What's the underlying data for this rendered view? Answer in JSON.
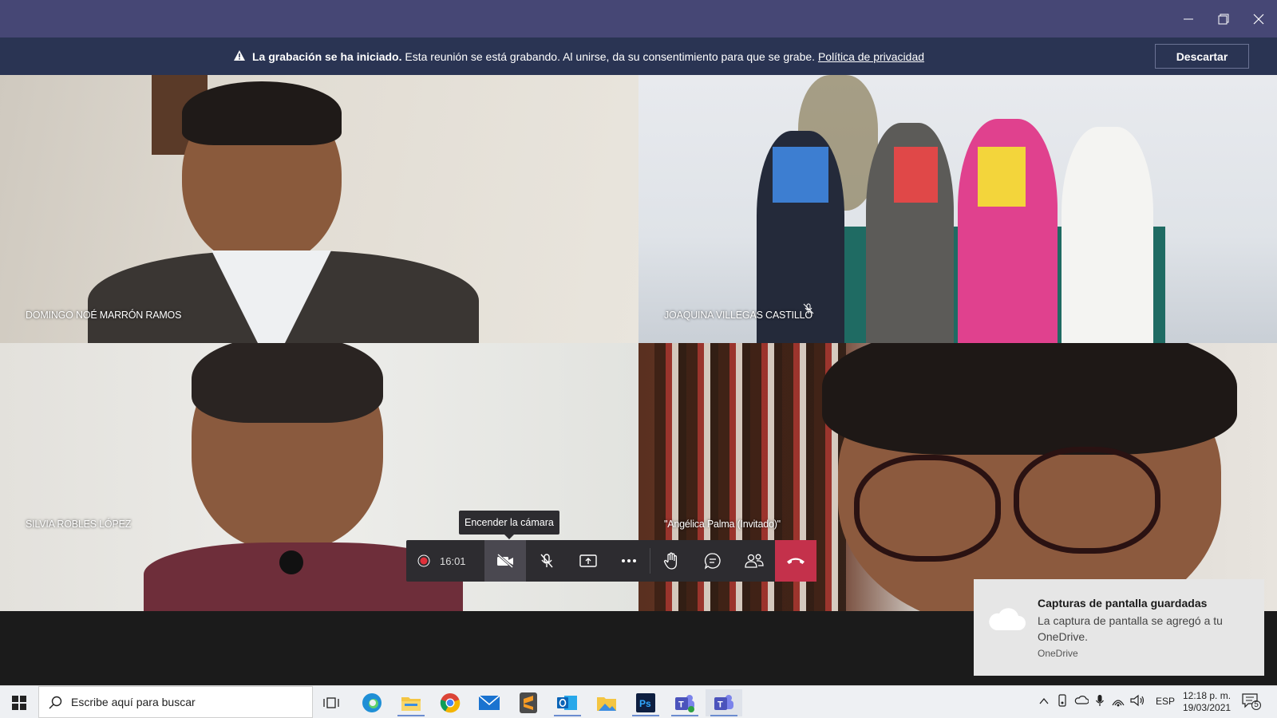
{
  "window": {
    "minimize_icon": "minimize-icon",
    "restore_icon": "restore-icon",
    "close_icon": "close-icon"
  },
  "banner": {
    "bold": "La grabación se ha iniciado.",
    "text": " Esta reunión se está grabando. Al unirse, da su consentimiento para que se grabe. ",
    "link": "Política de privacidad",
    "dismiss": "Descartar"
  },
  "participants": [
    {
      "name": "DOMINGO NOÉ MARRÓN RAMOS",
      "muted": false
    },
    {
      "name": "JOAQUINA VILLEGAS CASTILLO",
      "muted": true
    },
    {
      "name": "SILVIA ROBLES LÓPEZ",
      "muted": false
    },
    {
      "name": "\"Angélica Palma (Invitado)\"",
      "muted": false
    }
  ],
  "controls": {
    "timer": "16:01",
    "tooltip": "Encender la cámara",
    "hangup_color": "#c4314b"
  },
  "toast": {
    "title": "Capturas de pantalla guardadas",
    "body": "La captura de pantalla se agregó a tu OneDrive.",
    "source": "OneDrive"
  },
  "taskbar": {
    "search_placeholder": "Escribe aquí para buscar",
    "apps": [
      "task-view-icon",
      "edge-icon",
      "file-explorer-icon",
      "chrome-icon",
      "mail-icon",
      "sublime-icon",
      "outlook-icon",
      "photos-icon",
      "photoshop-icon",
      "teams-icon",
      "teams-icon"
    ],
    "language": "ESP",
    "time": "12:18 p. m.",
    "date": "19/03/2021",
    "notifications": "5"
  }
}
